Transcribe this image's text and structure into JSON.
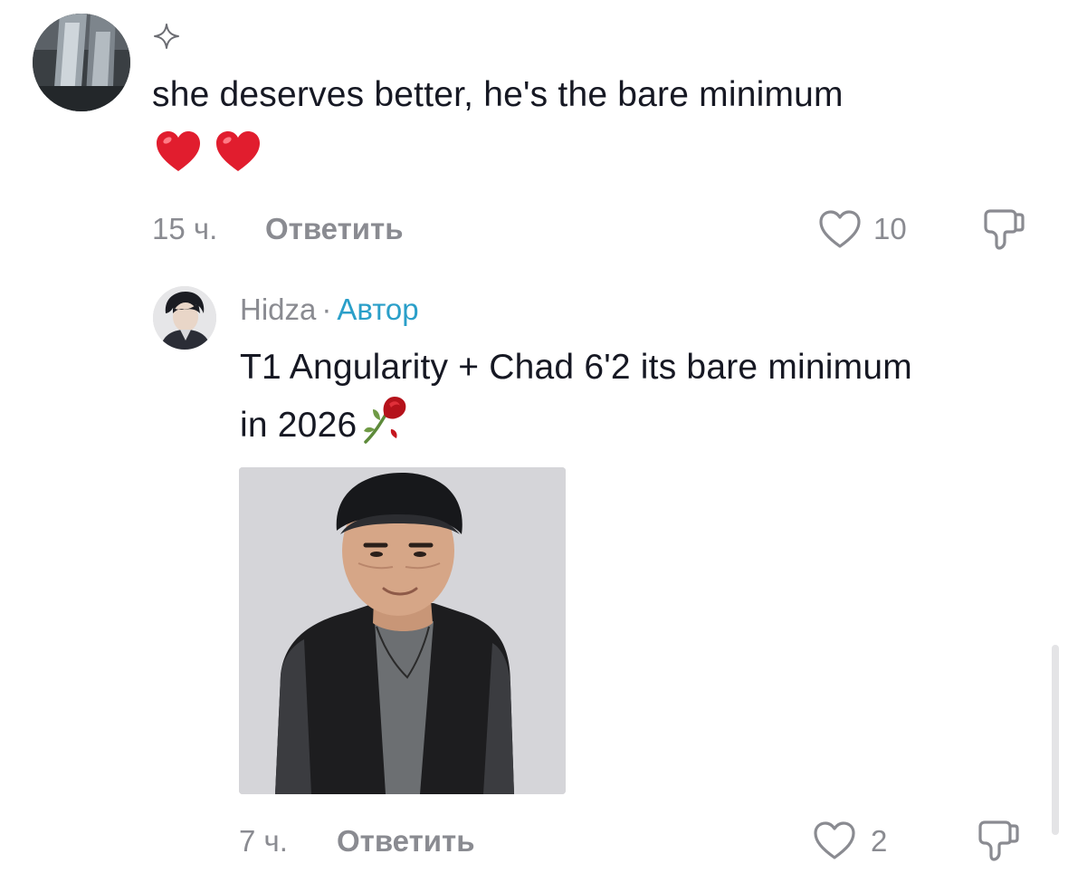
{
  "comments": [
    {
      "text": "she deserves better, he's the bare minimum",
      "emoji": [
        "heart-emoji",
        "heart-emoji"
      ],
      "time": "15 ч.",
      "reply_label": "Ответить",
      "likes": "10",
      "badge_icon": "sparkle-icon"
    },
    {
      "author": "Hidza",
      "separator": "·",
      "author_badge": "Автор",
      "text": "T1 Angularity + Chad 6'2 its bare minimum in 2026",
      "trailing_emoji": "wilted-rose-emoji",
      "time": "7 ч.",
      "reply_label": "Ответить",
      "likes": "2"
    }
  ],
  "colors": {
    "meta": "#8a8b91",
    "author_badge": "#2a9fc9",
    "text": "#161823",
    "heart": "#e11d2e"
  }
}
